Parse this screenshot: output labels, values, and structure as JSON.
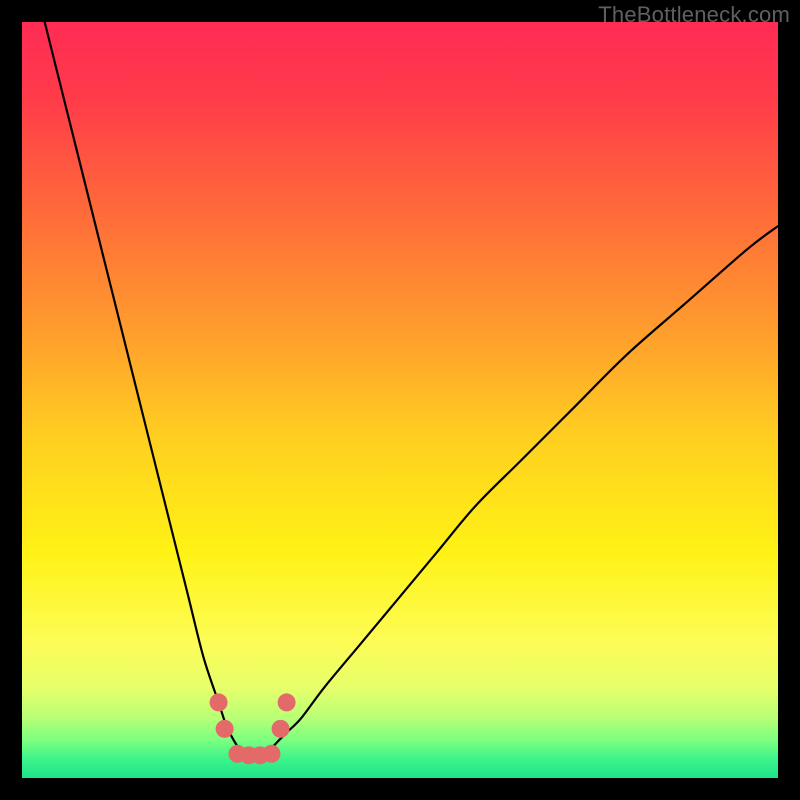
{
  "watermark": "TheBottleneck.com",
  "chart_data": {
    "type": "line",
    "title": "",
    "xlabel": "",
    "ylabel": "",
    "xlim": [
      0,
      100
    ],
    "ylim": [
      0,
      100
    ],
    "x": [
      3,
      6,
      9,
      12,
      14,
      17,
      20,
      22,
      24,
      26,
      27,
      28,
      29,
      29.5,
      30,
      31,
      32,
      33,
      34,
      35,
      37,
      40,
      45,
      50,
      55,
      60,
      66,
      73,
      80,
      88,
      96,
      100
    ],
    "y": [
      100,
      88,
      76,
      64,
      56,
      44,
      32,
      24,
      16,
      10,
      7,
      5,
      3.5,
      3,
      3,
      3,
      3.5,
      4,
      5,
      6,
      8,
      12,
      18,
      24,
      30,
      36,
      42,
      49,
      56,
      63,
      70,
      73
    ],
    "marker_points_x": [
      26,
      26.8,
      28.5,
      30,
      31.5,
      33,
      34.2,
      35
    ],
    "marker_points_y": [
      10,
      6.5,
      3.2,
      3,
      3,
      3.2,
      6.5,
      10
    ],
    "gradient_stops": [
      {
        "offset": 0.0,
        "color": "#ff2b55"
      },
      {
        "offset": 0.1,
        "color": "#ff3b4a"
      },
      {
        "offset": 0.25,
        "color": "#ff6a3a"
      },
      {
        "offset": 0.4,
        "color": "#ff9a2e"
      },
      {
        "offset": 0.55,
        "color": "#ffcf20"
      },
      {
        "offset": 0.7,
        "color": "#fff215"
      },
      {
        "offset": 0.82,
        "color": "#fdfc56"
      },
      {
        "offset": 0.88,
        "color": "#e7ff6a"
      },
      {
        "offset": 0.92,
        "color": "#b8ff75"
      },
      {
        "offset": 0.95,
        "color": "#7cff80"
      },
      {
        "offset": 0.975,
        "color": "#3cf48a"
      },
      {
        "offset": 1.0,
        "color": "#1fe28a"
      }
    ],
    "curve_color": "#000000",
    "marker_color": "#e46a6a"
  }
}
